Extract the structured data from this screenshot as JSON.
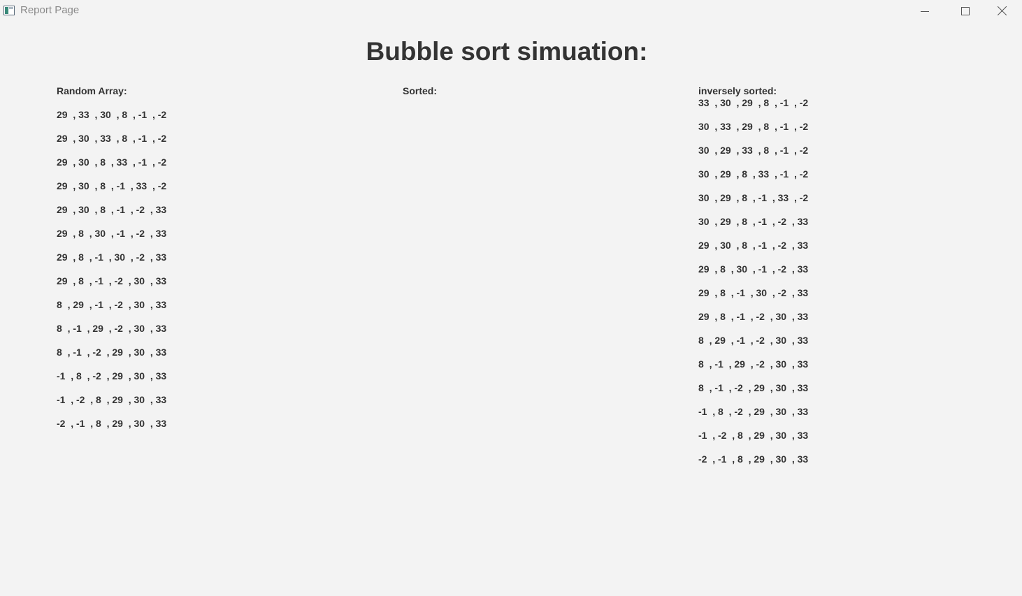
{
  "window": {
    "title": "Report Page",
    "icons": {
      "app": "window-app-icon",
      "minimize": "minimize-icon",
      "maximize": "maximize-icon",
      "close": "close-icon"
    }
  },
  "heading": "Bubble sort simuation:",
  "columns": {
    "random": {
      "label": "Random Array:",
      "rows": [
        "29  , 33  , 30  , 8  , -1  , -2",
        "29  , 30  , 33  , 8  , -1  , -2",
        "29  , 30  , 8  , 33  , -1  , -2",
        "29  , 30  , 8  , -1  , 33  , -2",
        "29  , 30  , 8  , -1  , -2  , 33",
        "29  , 8  , 30  , -1  , -2  , 33",
        "29  , 8  , -1  , 30  , -2  , 33",
        "29  , 8  , -1  , -2  , 30  , 33",
        "8  , 29  , -1  , -2  , 30  , 33",
        "8  , -1  , 29  , -2  , 30  , 33",
        "8  , -1  , -2  , 29  , 30  , 33",
        "-1  , 8  , -2  , 29  , 30  , 33",
        "-1  , -2  , 8  , 29  , 30  , 33",
        "-2  , -1  , 8  , 29  , 30  , 33"
      ]
    },
    "sorted": {
      "label": "Sorted:",
      "rows": []
    },
    "inverse": {
      "label": "inversely sorted:",
      "rows": [
        "33  , 30  , 29  , 8  , -1  , -2",
        "30  , 33  , 29  , 8  , -1  , -2",
        "30  , 29  , 33  , 8  , -1  , -2",
        "30  , 29  , 8  , 33  , -1  , -2",
        "30  , 29  , 8  , -1  , 33  , -2",
        "30  , 29  , 8  , -1  , -2  , 33",
        "29  , 30  , 8  , -1  , -2  , 33",
        "29  , 8  , 30  , -1  , -2  , 33",
        "29  , 8  , -1  , 30  , -2  , 33",
        "29  , 8  , -1  , -2  , 30  , 33",
        "8  , 29  , -1  , -2  , 30  , 33",
        "8  , -1  , 29  , -2  , 30  , 33",
        "8  , -1  , -2  , 29  , 30  , 33",
        "-1  , 8  , -2  , 29  , 30  , 33",
        "-1  , -2  , 8  , 29  , 30  , 33",
        "-2  , -1  , 8  , 29  , 30  , 33"
      ]
    }
  }
}
